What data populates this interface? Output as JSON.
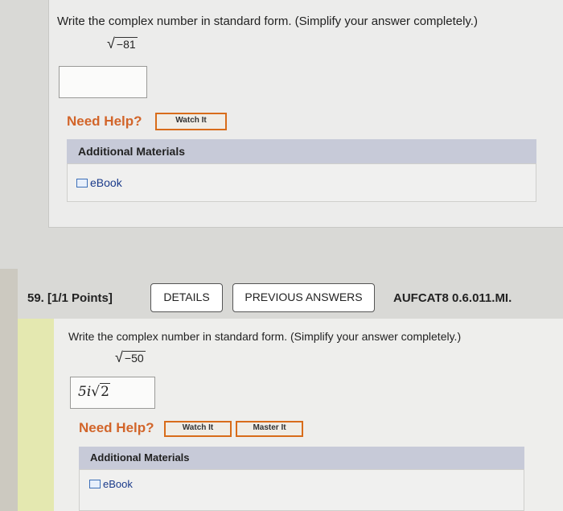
{
  "q58": {
    "prompt": "Write the complex number in standard form. (Simplify your answer completely.)",
    "radicand": "−81",
    "answer_value": "",
    "need_help": "Need Help?",
    "watch_it": "Watch It",
    "materials_header": "Additional Materials",
    "ebook": "eBook"
  },
  "q59": {
    "number_points": "59. [1/1 Points]",
    "details": "DETAILS",
    "previous_answers": "PREVIOUS ANSWERS",
    "code": "AUFCAT8 0.6.011.MI.",
    "prompt": "Write the complex number in standard form. (Simplify your answer completely.)",
    "radicand": "−50",
    "answer_coef": "5i",
    "answer_radicand": "2",
    "need_help": "Need Help?",
    "watch_it": "Watch It",
    "master_it": "Master It",
    "materials_header": "Additional Materials",
    "ebook": "eBook"
  },
  "colors": {
    "accent_orange": "#d86c1a",
    "materials_header_bg": "#c7cad8",
    "correct_stripe": "#e4e8b0"
  },
  "icons": [
    "radical-sign-icon",
    "book-icon"
  ]
}
